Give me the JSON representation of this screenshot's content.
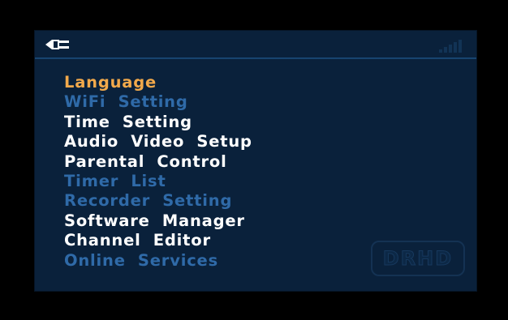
{
  "header": {
    "left_icon": "plug-icon",
    "right_icon": "signal-strength-icon"
  },
  "menu": {
    "items": [
      {
        "label": "Language",
        "state": "selected"
      },
      {
        "label": "WiFi  Setting",
        "state": "disabled"
      },
      {
        "label": "Time  Setting",
        "state": "enabled"
      },
      {
        "label": "Audio  Video  Setup",
        "state": "enabled"
      },
      {
        "label": "Parental  Control",
        "state": "enabled"
      },
      {
        "label": "Timer  List",
        "state": "disabled"
      },
      {
        "label": "Recorder  Setting",
        "state": "disabled"
      },
      {
        "label": "Software  Manager",
        "state": "enabled"
      },
      {
        "label": "Channel  Editor",
        "state": "enabled"
      },
      {
        "label": "Online  Services",
        "state": "disabled"
      }
    ]
  },
  "watermark": {
    "text": "DRHD"
  },
  "colors": {
    "background": "#000000",
    "panel": "#0a213b",
    "selected": "#f2a94b",
    "enabled": "#ffffff",
    "disabled": "#2f6aa8",
    "accent_line": "#1d4f80"
  }
}
